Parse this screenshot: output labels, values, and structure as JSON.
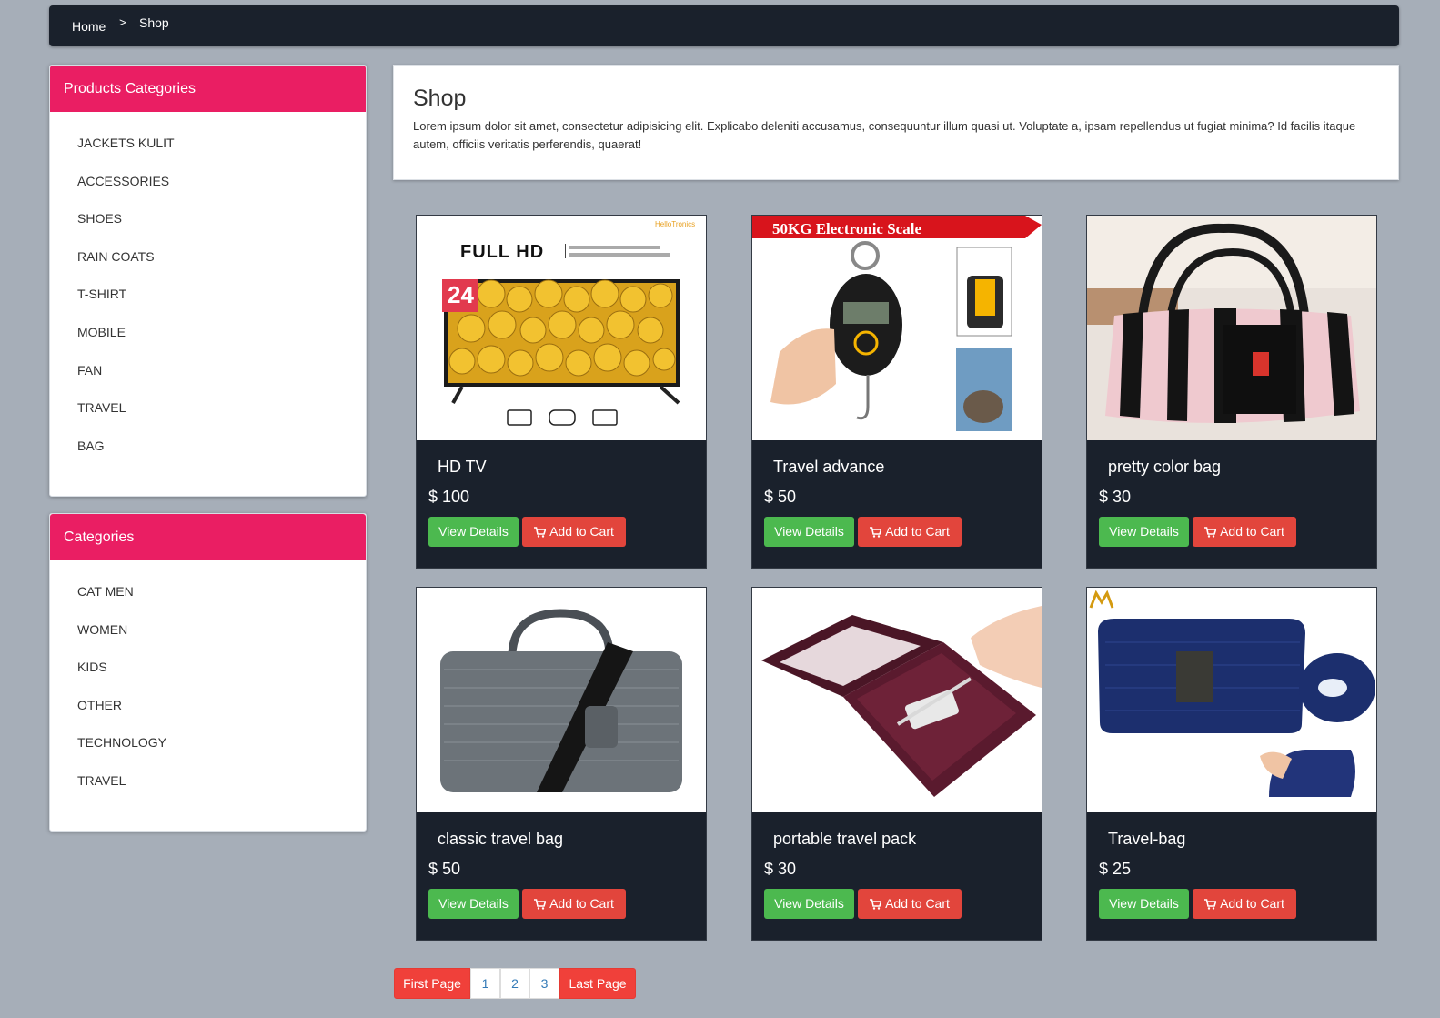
{
  "breadcrumb": {
    "home": "Home",
    "separator": ">",
    "current": "Shop"
  },
  "sidebar_products": {
    "title": "Products Categories",
    "items": [
      "JACKETS KULIT",
      "ACCESSORIES",
      "SHOES",
      "RAIN COATS",
      "T-SHIRT",
      "MOBILE",
      "FAN",
      "TRAVEL",
      "BAG"
    ]
  },
  "sidebar_categories": {
    "title": "Categories",
    "items": [
      "CAT MEN",
      "WOMEN",
      "KIDS",
      "OTHER",
      "TECHNOLOGY",
      "TRAVEL"
    ]
  },
  "intro": {
    "title": "Shop",
    "text": "Lorem ipsum dolor sit amet, consectetur adipisicing elit. Explicabo deleniti accusamus, consequuntur illum quasi ut. Voluptate a, ipsam repellendus ut fugiat minima? Id facilis itaque autem, officiis veritatis perferendis, quaerat!"
  },
  "buttons": {
    "view": "View Details",
    "cart": "Add to Cart"
  },
  "products": [
    {
      "name": "HD TV",
      "price": "$ 100",
      "image": "tv-image",
      "image_text": {
        "headline": "FULL HD",
        "badge": "24",
        "brand": "HelloTronics"
      }
    },
    {
      "name": "Travel advance",
      "price": "$ 50",
      "image": "electronic-scale-image",
      "image_text": {
        "headline": "50KG Electronic Scale"
      }
    },
    {
      "name": "pretty color bag",
      "price": "$ 30",
      "image": "striped-duffel-bag-image"
    },
    {
      "name": "classic travel bag",
      "price": "$ 50",
      "image": "laptop-bag-image"
    },
    {
      "name": "portable travel pack",
      "price": "$ 30",
      "image": "travel-organizer-image"
    },
    {
      "name": "Travel-bag",
      "price": "$ 25",
      "image": "blue-pouch-image"
    }
  ],
  "pagination": {
    "first": "First Page",
    "pages": [
      "1",
      "2",
      "3"
    ],
    "last": "Last Page"
  },
  "colors": {
    "accent": "#ea1e63",
    "dark": "#1a212c",
    "success": "#4cb94f",
    "danger": "#e2453c",
    "background": "#a6aeb8"
  }
}
